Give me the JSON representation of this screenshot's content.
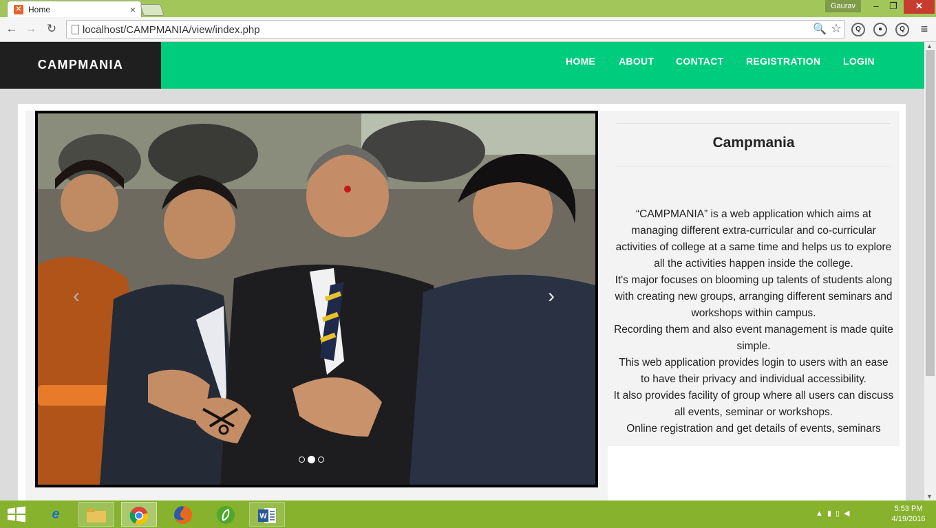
{
  "browser": {
    "tab_title": "Home",
    "tab_favicon": "xampp-icon",
    "tab_close": "×",
    "user_name": "Gaurav",
    "window_controls": {
      "minimize": "–",
      "maximize": "❐",
      "close": "✕"
    },
    "nav": {
      "back": "←",
      "forward": "→",
      "reload": "↻"
    },
    "url_host": "localhost",
    "url_path": "/CAMPMANIA/view/index.php",
    "url": "localhost/CAMPMANIA/view/index.php",
    "omnibox_icons": {
      "zoom": "🔍",
      "star": "☆"
    },
    "extensions": [
      "search-extension-icon",
      "privacy-extension-icon",
      "zoom-extension-icon"
    ],
    "menu_glyph": "≡"
  },
  "site": {
    "brand": "CAMPMANIA",
    "nav_links": [
      "HOME",
      "ABOUT",
      "CONTACT",
      "REGISTRATION",
      "LOGIN"
    ],
    "carousel": {
      "prev_glyph": "‹",
      "next_glyph": "›",
      "slide_count": 3,
      "active_index": 1
    },
    "info": {
      "title": "Campmania",
      "paragraphs": [
        "“CAMPMANIA” is a web application which aims at managing different extra-curricular and co-curricular activities of college at a same time and helps us to explore all the activities happen inside the college.",
        "It's major focuses on blooming up talents of students along with creating new groups, arranging different seminars and workshops within campus.",
        "Recording them and also event management is made quite simple.",
        "This web application provides login to users with an ease to have their privacy and individual accessibility.",
        "It also provides facility of group where all users can discuss all events, seminar or workshops.",
        "Online registration and get details of events, seminars"
      ]
    }
  },
  "colors": {
    "navbar": "#00cc7e",
    "brand_bg": "#1f1f1f",
    "taskbar": "#86b22e",
    "titlebar": "#a3c65a"
  },
  "taskbar": {
    "apps": [
      "Internet Explorer",
      "File Explorer",
      "Google Chrome",
      "Firefox",
      "Dreamweaver",
      "Word"
    ],
    "time": "5:53 PM",
    "date": "4/19/2016"
  }
}
